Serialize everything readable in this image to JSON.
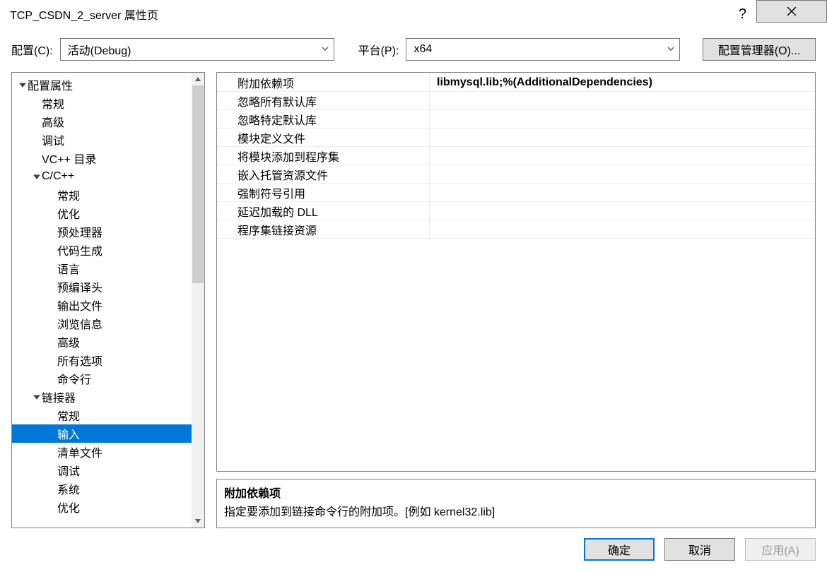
{
  "title": "TCP_CSDN_2_server 属性页",
  "titlebar": {
    "help_tooltip": "?",
    "close_tooltip": "关闭"
  },
  "config": {
    "label": "配置(C):",
    "value": "活动(Debug)"
  },
  "platform": {
    "label": "平台(P):",
    "value": "x64"
  },
  "config_manager_button": "配置管理器(O)...",
  "tree": {
    "root": "配置属性",
    "items_l1": [
      "常规",
      "高级",
      "调试",
      "VC++ 目录"
    ],
    "cpp": {
      "label": "C/C++",
      "items": [
        "常规",
        "优化",
        "预处理器",
        "代码生成",
        "语言",
        "预编译头",
        "输出文件",
        "浏览信息",
        "高级",
        "所有选项",
        "命令行"
      ]
    },
    "linker": {
      "label": "链接器",
      "items": [
        "常规",
        "输入",
        "清单文件",
        "调试",
        "系统",
        "优化"
      ]
    },
    "selected_path": "链接器 > 输入"
  },
  "properties": [
    {
      "name": "附加依赖项",
      "value": "libmysql.lib;%(AdditionalDependencies)",
      "selected": true
    },
    {
      "name": "忽略所有默认库",
      "value": ""
    },
    {
      "name": "忽略特定默认库",
      "value": ""
    },
    {
      "name": "模块定义文件",
      "value": ""
    },
    {
      "name": "将模块添加到程序集",
      "value": ""
    },
    {
      "name": "嵌入托管资源文件",
      "value": ""
    },
    {
      "name": "强制符号引用",
      "value": ""
    },
    {
      "name": "延迟加载的 DLL",
      "value": ""
    },
    {
      "name": "程序集链接资源",
      "value": ""
    }
  ],
  "description": {
    "title": "附加依赖项",
    "body": "指定要添加到链接命令行的附加项。[例如 kernel32.lib]"
  },
  "buttons": {
    "ok": "确定",
    "cancel": "取消",
    "apply": "应用(A)"
  }
}
